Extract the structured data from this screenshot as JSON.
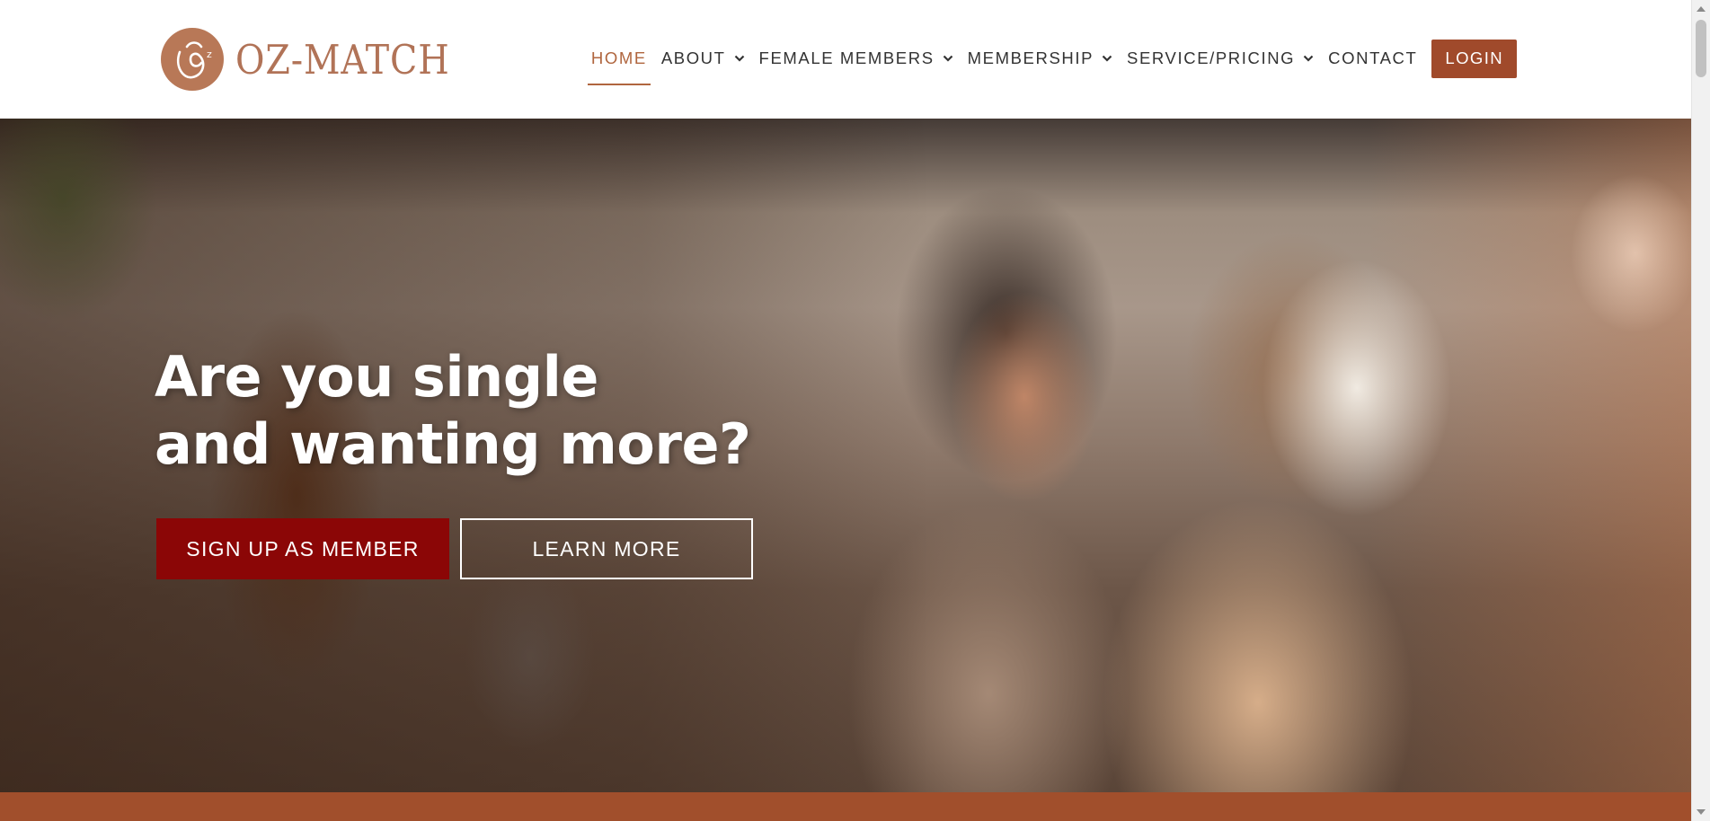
{
  "brand": {
    "name": "OZ-MATCH",
    "color": "#b17357"
  },
  "nav": {
    "items": [
      {
        "label": "HOME",
        "active": true,
        "has_dropdown": false
      },
      {
        "label": "ABOUT",
        "active": false,
        "has_dropdown": true
      },
      {
        "label": "FEMALE MEMBERS",
        "active": false,
        "has_dropdown": true
      },
      {
        "label": "MEMBERSHIP",
        "active": false,
        "has_dropdown": true
      },
      {
        "label": "SERVICE/PRICING",
        "active": false,
        "has_dropdown": true
      },
      {
        "label": "CONTACT",
        "active": false,
        "has_dropdown": false
      }
    ],
    "login_label": "LOGIN",
    "active_color": "#b0663f",
    "dropdown_icon": "chevron-down-icon"
  },
  "hero": {
    "headline_line1": "Are you single",
    "headline_line2": "and wanting more?",
    "primary_button": "SIGN UP AS MEMBER",
    "secondary_button": "LEARN MORE",
    "primary_color": "#8b0606"
  },
  "colors": {
    "login_bg": "#a04a2b",
    "footer_strip": "#a14f2c"
  }
}
